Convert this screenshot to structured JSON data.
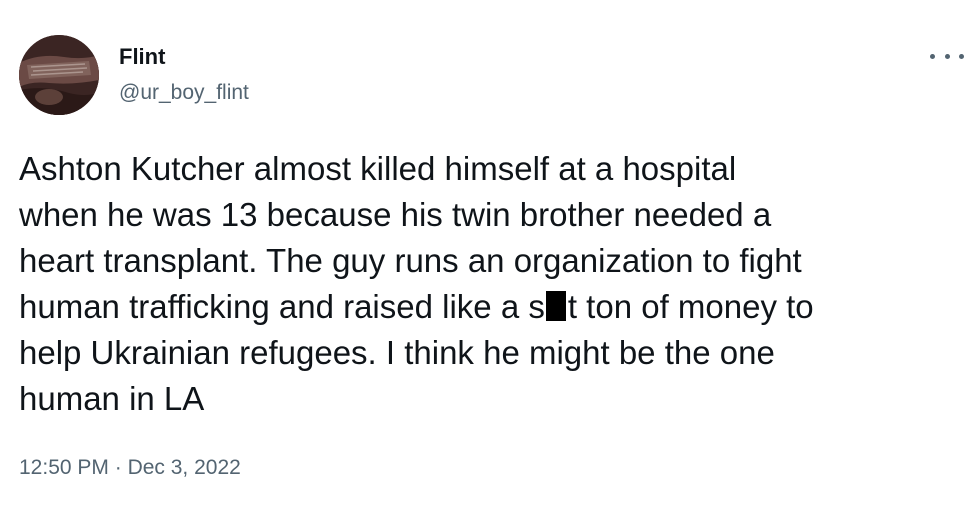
{
  "author": {
    "display_name": "Flint",
    "handle": "@ur_boy_flint"
  },
  "tweet": {
    "lines": [
      "Ashton Kutcher almost killed himself at a hospital",
      "when he was 13 because his twin brother needed a",
      "heart transplant. The guy runs an organization to fight",
      "help Ukrainian refugees. I think he might be the one",
      "human in LA"
    ],
    "censored_line": {
      "before": "human trafficking and raised like a s",
      "after": "t ton of money to"
    }
  },
  "meta": {
    "time": "12:50 PM",
    "separator": "·",
    "date": "Dec 3, 2022"
  },
  "icons": {
    "more": "more-options-icon"
  },
  "colors": {
    "text": "#0f1419",
    "secondary": "#536471",
    "censor_bar": "#000000"
  }
}
